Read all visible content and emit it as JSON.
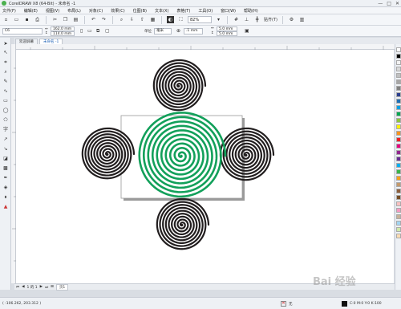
{
  "window": {
    "title": "CorelDRAW X8 (64-Bit) - 未命名 -1",
    "min": "—",
    "max": "□",
    "close": "✕"
  },
  "menu": [
    "文件(F)",
    "编辑(E)",
    "视图(V)",
    "布局(L)",
    "对象(C)",
    "效果(C)",
    "位图(B)",
    "文本(X)",
    "表格(T)",
    "工具(O)",
    "窗口(W)",
    "帮助(H)"
  ],
  "toolbar": {
    "zoom": "82%",
    "snap_label": "贴齐(T)"
  },
  "propbar": {
    "preset": "C6",
    "width": "162.0 mm",
    "height": "114.0 mm",
    "unit_label": "单位",
    "unit": "毫米",
    "nudge": ".1 mm",
    "dup_x": "5.0 mm",
    "dup_y": "5.0 mm"
  },
  "tabs": [
    "欢迎屏幕",
    "未命名 -1"
  ],
  "pagebar": {
    "page_counter": "1 的 1",
    "page_tab": "页1"
  },
  "status": {
    "coords": "( -106.262, 203.312 )",
    "outline": "无",
    "fill": "C:0 M:0 Y:0 K:100"
  },
  "watermark": "Bai 经验",
  "palette_colors": [
    "#ffffff",
    "#000000",
    "#f2f2f2",
    "#d9d9d9",
    "#bfbfbf",
    "#a6a6a6",
    "#808080",
    "#2b3f8f",
    "#1f6fb5",
    "#00a0e3",
    "#00a651",
    "#8dc63f",
    "#fff200",
    "#f7941d",
    "#ed1c24",
    "#e6007e",
    "#92278f",
    "#662d91",
    "#00aeef",
    "#39b54a",
    "#f6a01a",
    "#c49a6c",
    "#8b5e3c",
    "#754c24",
    "#f8c1c1",
    "#f49ac1",
    "#c7b299",
    "#a3d5f2",
    "#cfe8a9",
    "#fbdcb2"
  ]
}
